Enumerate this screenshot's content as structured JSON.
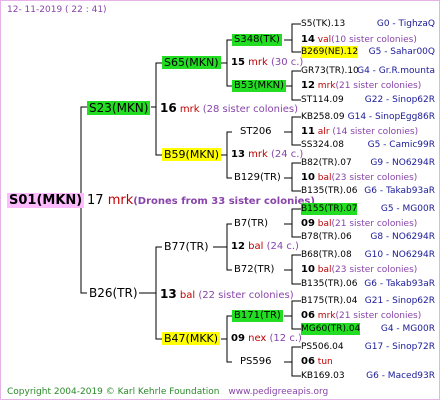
{
  "header": {
    "date": "12- 11-2019 ( 22 : 41)"
  },
  "footer": {
    "copyright": "Copyright 2004-2019 © Karl Kehrle Foundation",
    "site": "www.pedigreeapis.org"
  },
  "root": {
    "name": "S01(MKN)",
    "num": "17",
    "kind": "mrk",
    "note": "(Drones from 33 sister colonies)"
  },
  "gen1": [
    {
      "name": "S23(MKN)",
      "num": "16",
      "kind": "mrk",
      "note": "(28 sister colonies)"
    },
    {
      "name": "B26(TR)",
      "num": "13",
      "kind": "bal",
      "note": "(22 sister colonies)"
    }
  ],
  "gen2": [
    {
      "name": "S65(MKN)",
      "num": "15",
      "kind": "mrk",
      "note": "(30 c.)"
    },
    {
      "name": "B59(MKN)",
      "num": "13",
      "kind": "mrk",
      "note": "(24 c.)"
    },
    {
      "name": "B77(TR)",
      "num": "12",
      "kind": "bal",
      "note": "(24 c.)"
    },
    {
      "name": "B47(MKK)",
      "num": "09",
      "kind": "nex",
      "note": "(12 c.)"
    }
  ],
  "gen3": [
    {
      "name": "S348(TK)",
      "num": "14",
      "kind": "val",
      "note": "(10 sister colonies)"
    },
    {
      "name": "B53(MKN)",
      "num": "12",
      "kind": "mrk",
      "note": "(21 sister colonies)"
    },
    {
      "name": "ST206",
      "num": "11",
      "kind": "alr",
      "note": "(14 sister colonies)"
    },
    {
      "name": "B129(TR)",
      "num": "10",
      "kind": "bal",
      "note": "(23 sister colonies)"
    },
    {
      "name": "B7(TR)",
      "num": "09",
      "kind": "bal",
      "note": "(21 sister colonies)"
    },
    {
      "name": "B72(TR)",
      "num": "10",
      "kind": "bal",
      "note": "(23 sister colonies)"
    },
    {
      "name": "B171(TR)",
      "num": "06",
      "kind": "mrk",
      "note": "(21 sister colonies)"
    },
    {
      "name": "PS596",
      "num": "06",
      "kind": "tun",
      "note": ""
    }
  ],
  "gen4": [
    {
      "name": "S5(TK).13",
      "info": "G0 - TighzaQ"
    },
    {
      "name": "B269(NE).12",
      "info": "G5 - Sahar00Q"
    },
    {
      "name": "GR73(TR).10",
      "info": "G4 - Gr.R.mounta"
    },
    {
      "name": "ST114.09",
      "info": "G22 - Sinop62R"
    },
    {
      "name": "KB258.09",
      "info": "G14 - SinopEgg86R"
    },
    {
      "name": "SS324.08",
      "info": "G5 - Camic99R"
    },
    {
      "name": "B82(TR).07",
      "info": "G9 - NO6294R"
    },
    {
      "name": "B135(TR).06",
      "info": "G6 - Takab93aR"
    },
    {
      "name": "B155(TR).07",
      "info": "G5 - MG00R"
    },
    {
      "name": "B78(TR).06",
      "info": "G8 - NO6294R"
    },
    {
      "name": "B68(TR).08",
      "info": "G10 - NO6294R"
    },
    {
      "name": "B135(TR).06",
      "info": "G6 - Takab93aR"
    },
    {
      "name": "B175(TR).04",
      "info": "G21 - Sinop62R"
    },
    {
      "name": "MG60(TR).04",
      "info": "G4 - MG00R"
    },
    {
      "name": "PS506.04",
      "info": "G17 - Sinop72R"
    },
    {
      "name": "KB169.03",
      "info": "G6 - Maced93R"
    }
  ]
}
